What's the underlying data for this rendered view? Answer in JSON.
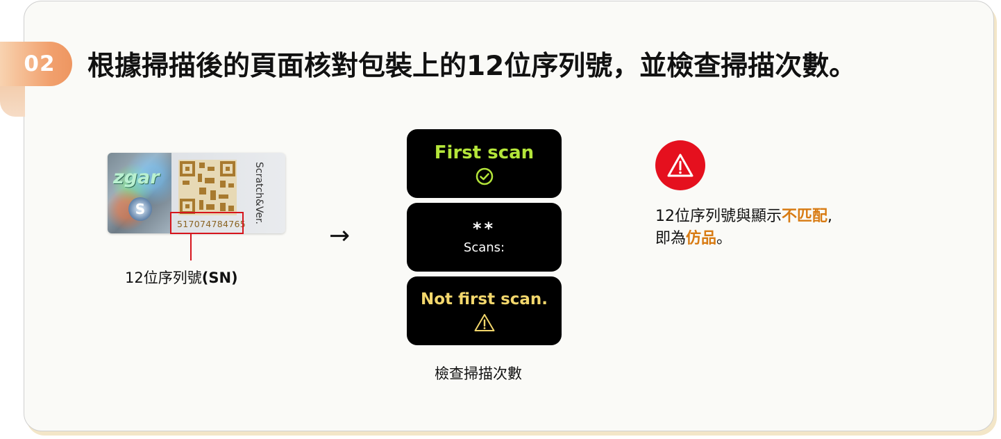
{
  "step": {
    "number": "02",
    "title": "根據掃描後的頁面核對包裝上的12位序列號，並檢查掃描次數。"
  },
  "label": {
    "brand_logo": "zgar",
    "serial_number": "517074784765",
    "vertical_text": "Scratch&Ver.",
    "caption_main": "12位序列號",
    "caption_bold": "(SN)"
  },
  "arrow": "→",
  "screens": {
    "first": {
      "title": "First scan",
      "icon": "check-circle-icon",
      "color": "#b4e53a"
    },
    "count": {
      "value": "**",
      "label": "Scans:"
    },
    "not_first": {
      "title": "Not first scan.",
      "icon": "warning-triangle-icon",
      "color": "#f3d76c"
    },
    "caption": "檢查掃描次數"
  },
  "warning": {
    "icon": "warning-triangle-icon",
    "line1_prefix": "12位序列號與顯示",
    "line1_highlight": "不匹配",
    "line1_suffix": ",",
    "line2_prefix": "即為",
    "line2_highlight": "仿品",
    "line2_suffix": "。",
    "accent_color": "#d87b13",
    "icon_color": "#e5101e"
  }
}
